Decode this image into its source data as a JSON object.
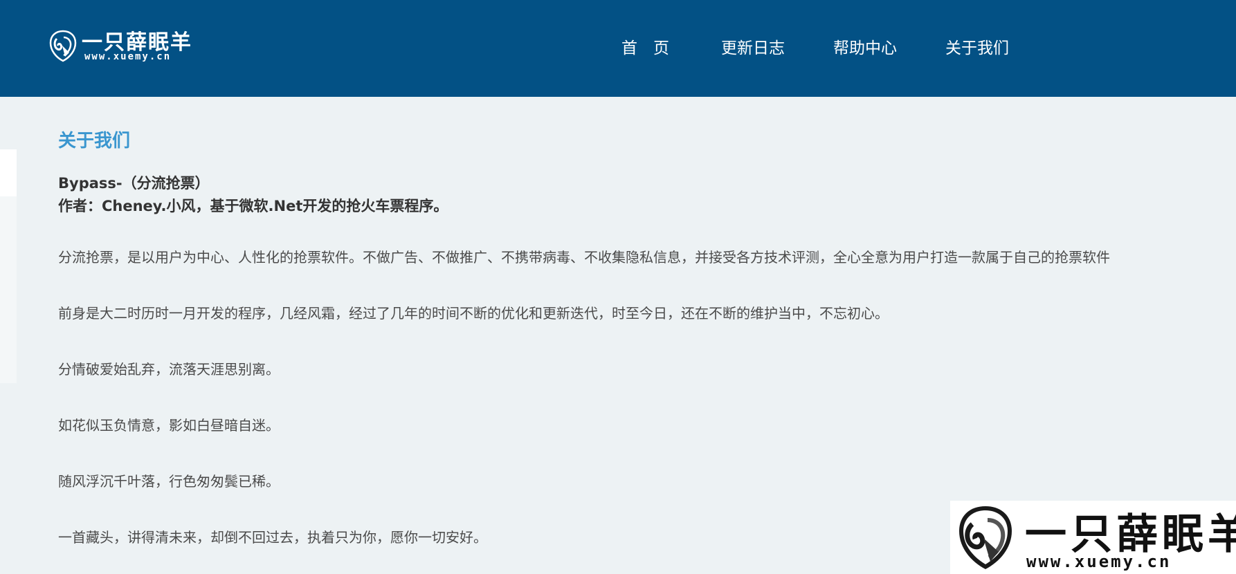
{
  "header": {
    "logo_title": "一只薛眠羊",
    "logo_url": "www.xuemy.cn",
    "nav": [
      {
        "label": "首　页"
      },
      {
        "label": "更新日志"
      },
      {
        "label": "帮助中心"
      },
      {
        "label": "关于我们"
      }
    ]
  },
  "main": {
    "title": "关于我们",
    "intro": [
      "Bypass-（分流抢票）",
      "作者：Cheney.小风，基于微软.Net开发的抢火车票程序。"
    ],
    "paragraphs": [
      "分流抢票，是以用户为中心、人性化的抢票软件。不做广告、不做推广、不携带病毒、不收集隐私信息，并接受各方技术评测，全心全意为用户打造一款属于自己的抢票软件",
      "前身是大二时历时一月开发的程序，几经风霜，经过了几年的时间不断的优化和更新迭代，时至今日，还在不断的维护当中，不忘初心。",
      "分情破爱始乱弃，流落天涯思别离。",
      "如花似玉负情意，影如白昼暗自迷。",
      "随风浮沉千叶落，行色匆匆鬓已稀。",
      "一首藏头，讲得清未来，却倒不回过去，执着只为你，愿你一切安好。"
    ]
  },
  "watermark": {
    "title": "一只薛眠羊",
    "url": "www.xuemy.cn"
  },
  "colors": {
    "header_bg": "#035185",
    "page_bg": "#edf2f4",
    "title_accent": "#3a96cf"
  },
  "icons": {
    "logo": "ram-head-icon"
  }
}
